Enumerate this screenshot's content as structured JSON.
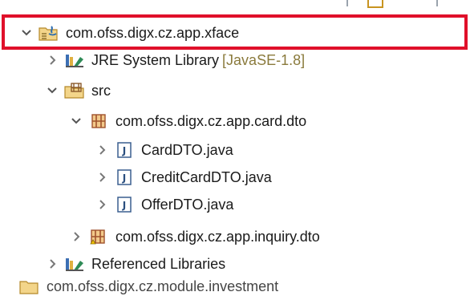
{
  "tree": {
    "project": {
      "label": "com.ofss.digx.cz.app.xface",
      "icon": "java-project-icon",
      "expanded": true
    },
    "jre": {
      "label": "JRE System Library",
      "decoration": "[JavaSE-1.8]",
      "icon": "library-icon"
    },
    "src": {
      "label": "src",
      "icon": "source-folder-icon",
      "expanded": true
    },
    "package_card": {
      "label": "com.ofss.digx.cz.app.card.dto",
      "icon": "package-icon",
      "expanded": true
    },
    "files": [
      {
        "label": "CardDTO.java",
        "icon": "java-file-icon"
      },
      {
        "label": "CreditCardDTO.java",
        "icon": "java-file-icon"
      },
      {
        "label": "OfferDTO.java",
        "icon": "java-file-icon"
      }
    ],
    "package_inquiry": {
      "label": "com.ofss.digx.cz.app.inquiry.dto",
      "icon": "package-icon"
    },
    "ref_libs": {
      "label": "Referenced Libraries",
      "icon": "library-icon"
    },
    "next_project": {
      "label": "com.ofss.digx.cz.module.investment",
      "icon": "java-project-icon"
    }
  },
  "colors": {
    "highlight": "#e0102a",
    "decoration": "#8a7a3c"
  }
}
